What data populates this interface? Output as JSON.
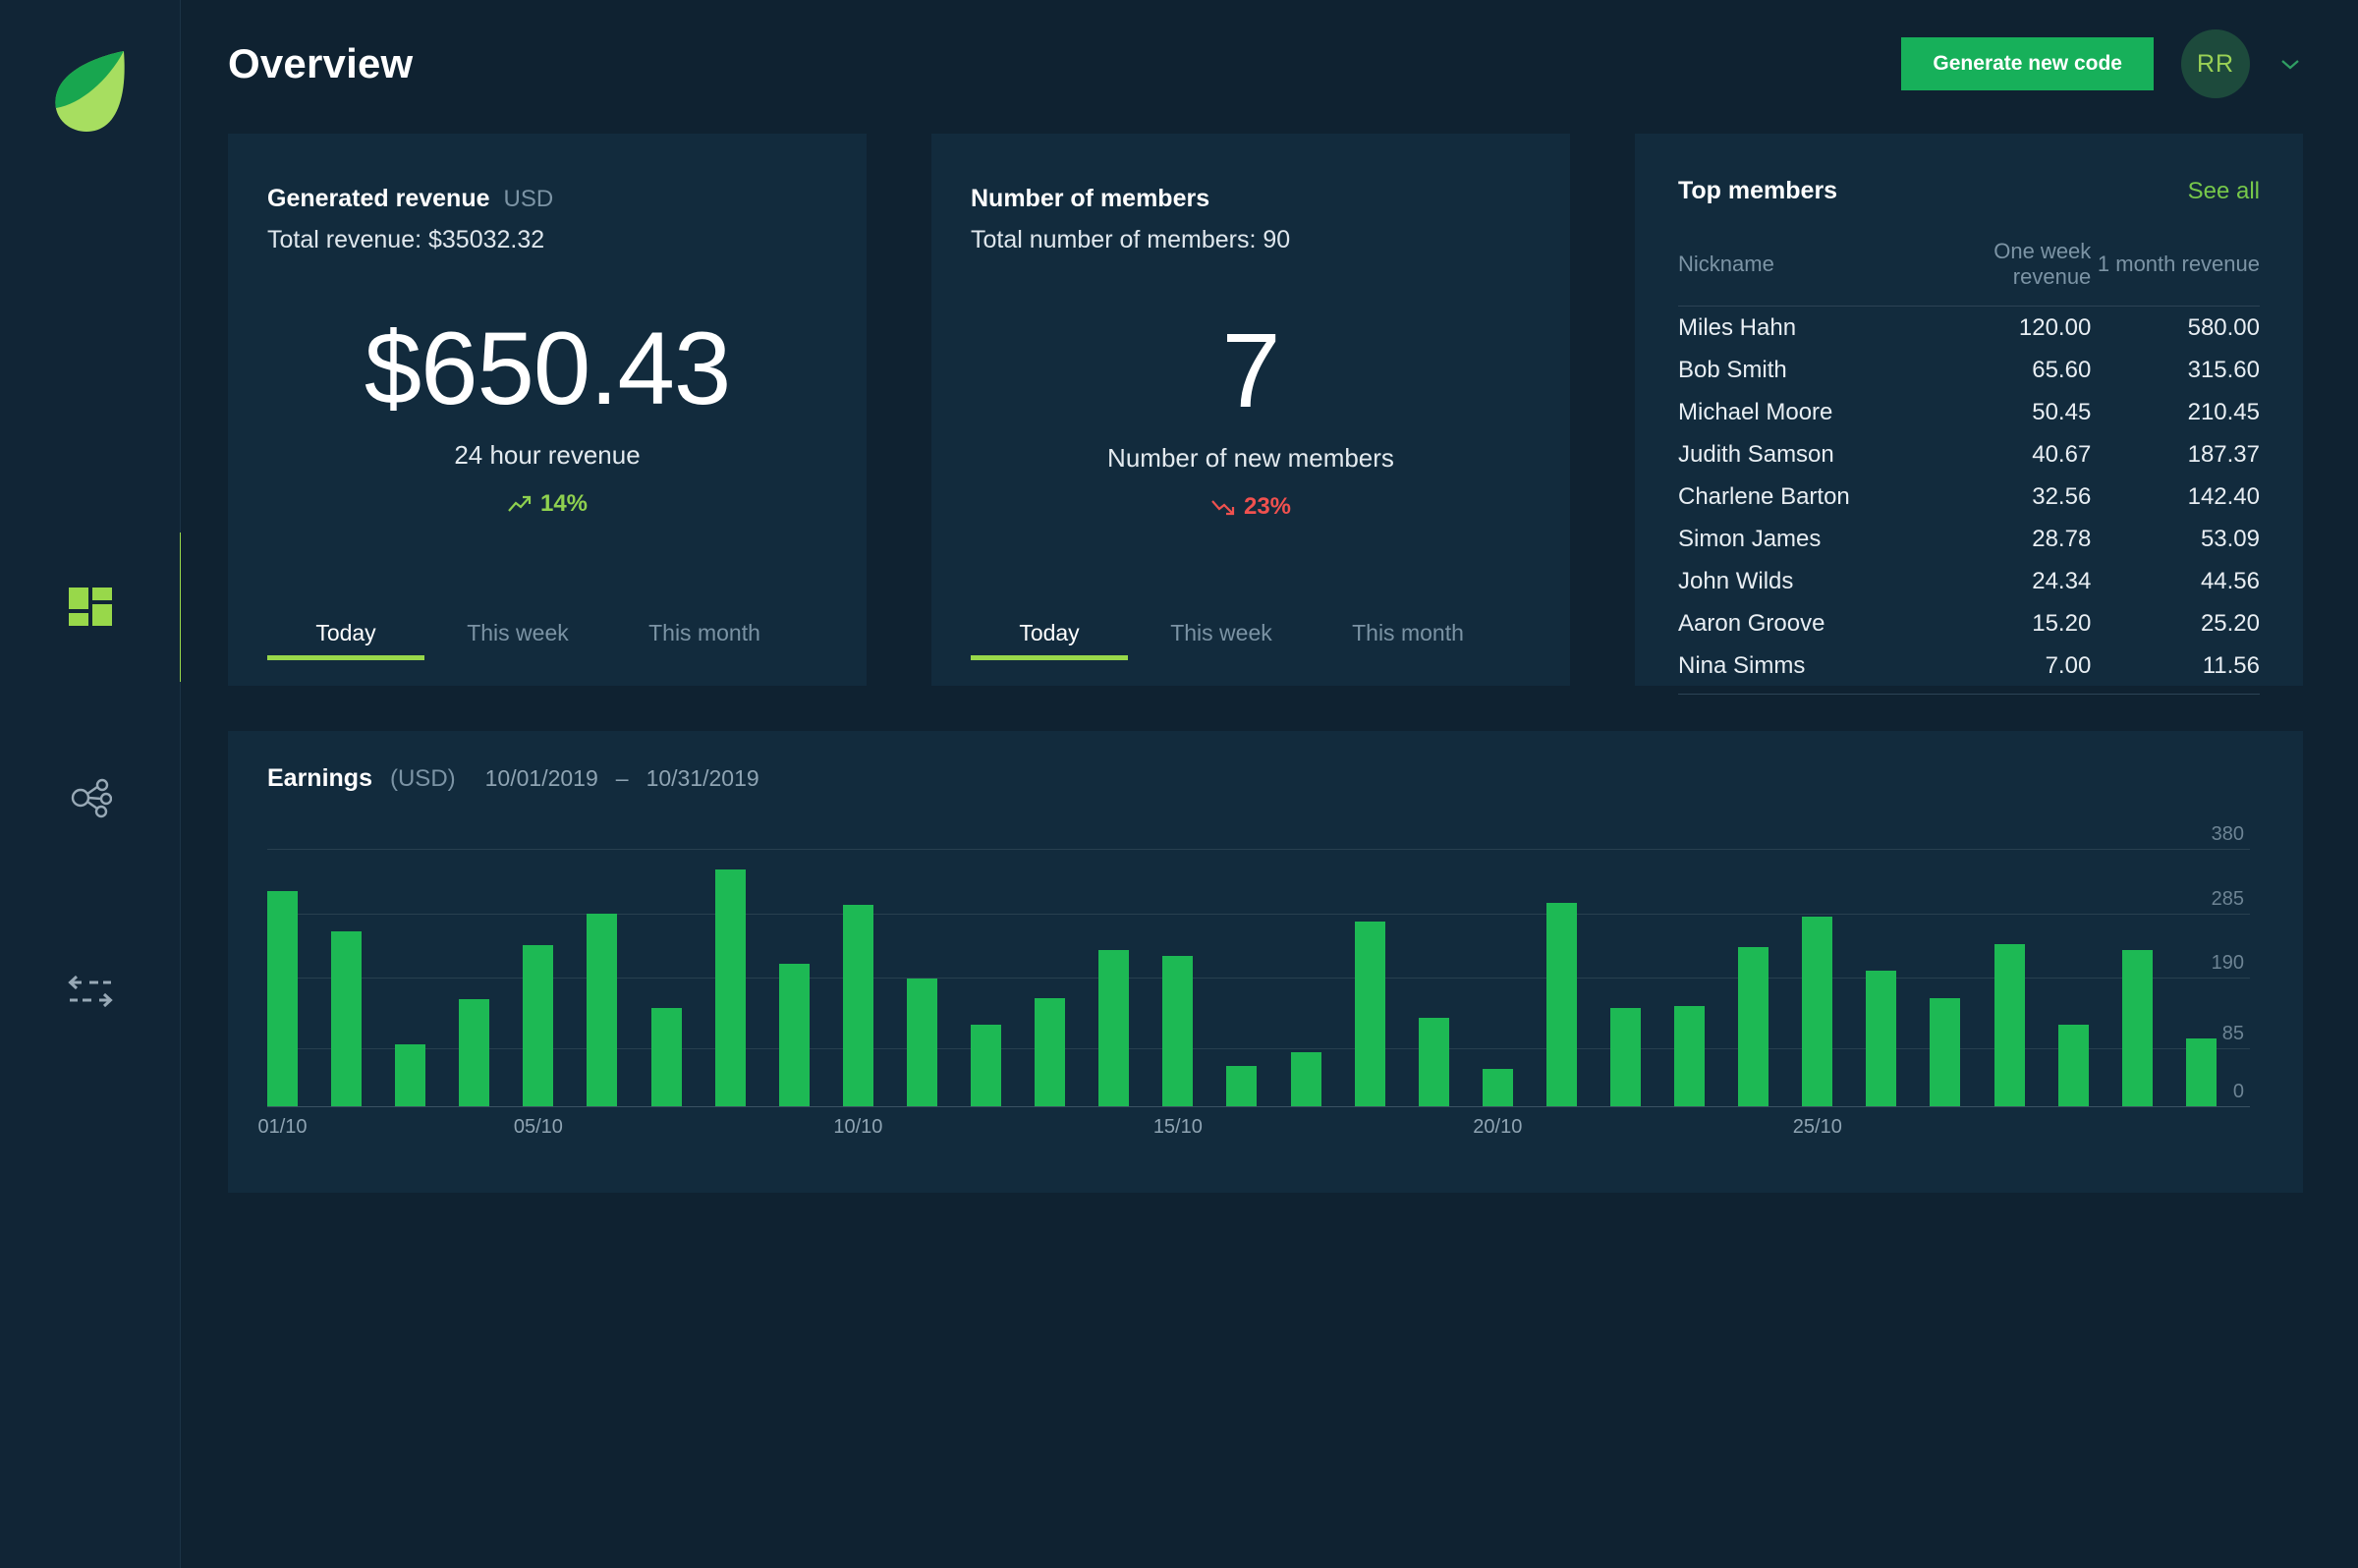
{
  "app": {
    "logo_icon": "leaf-logo",
    "accent_green": "#17b05a",
    "accent_lime": "#98d84a",
    "bg": "#0f2231",
    "card_bg": "#122b3d"
  },
  "sidebar": {
    "items": [
      {
        "icon": "dashboard-grid-icon",
        "label": "Dashboard",
        "active": true
      },
      {
        "icon": "network-share-icon",
        "label": "Referrals",
        "active": false
      },
      {
        "icon": "transfer-arrows-icon",
        "label": "Transfers",
        "active": false
      }
    ]
  },
  "header": {
    "title": "Overview",
    "generate_button": "Generate new code",
    "avatar_initials": "RR",
    "chevron_icon": "chevron-down-icon"
  },
  "revenue_card": {
    "title": "Generated revenue",
    "unit": "USD",
    "subtitle": "Total revenue: $35032.32",
    "value": "$650.43",
    "caption": "24 hour revenue",
    "delta": "14%",
    "delta_direction": "up",
    "delta_icon": "trend-up-icon",
    "delta_color": "#8fd14f",
    "tabs": [
      "Today",
      "This week",
      "This month"
    ],
    "active_tab": "Today"
  },
  "members_card": {
    "title": "Number of members",
    "subtitle": "Total number of members: 90",
    "value": "7",
    "caption": "Number of new members",
    "delta": "23%",
    "delta_direction": "down",
    "delta_icon": "trend-down-icon",
    "delta_color": "#f0514f",
    "tabs": [
      "Today",
      "This week",
      "This month"
    ],
    "active_tab": "Today"
  },
  "top_members": {
    "title": "Top members",
    "see_all": "See all",
    "columns": [
      "Nickname",
      "One week revenue",
      "1 month revenue"
    ],
    "rows": [
      {
        "nickname": "Miles Hahn",
        "week": "120.00",
        "month": "580.00"
      },
      {
        "nickname": "Bob Smith",
        "week": "65.60",
        "month": "315.60"
      },
      {
        "nickname": "Michael Moore",
        "week": "50.45",
        "month": "210.45"
      },
      {
        "nickname": "Judith Samson",
        "week": "40.67",
        "month": "187.37"
      },
      {
        "nickname": "Charlene Barton",
        "week": "32.56",
        "month": "142.40"
      },
      {
        "nickname": "Simon James",
        "week": "28.78",
        "month": "53.09"
      },
      {
        "nickname": "John Wilds",
        "week": "24.34",
        "month": "44.56"
      },
      {
        "nickname": "Aaron Groove",
        "week": "15.20",
        "month": "25.20"
      },
      {
        "nickname": "Nina Simms",
        "week": "7.00",
        "month": "11.56"
      }
    ]
  },
  "earnings": {
    "title": "Earnings",
    "unit": "(USD)",
    "date_from": "10/01/2019",
    "date_sep": "–",
    "date_to": "10/31/2019"
  },
  "chart_data": {
    "type": "bar",
    "title": "Earnings",
    "xlabel": "",
    "ylabel": "USD",
    "ylim": [
      0,
      380
    ],
    "grid": true,
    "bar_color": "#1db954",
    "yticks": [
      0,
      85,
      190,
      285,
      380
    ],
    "xticks": [
      "01/10",
      "05/10",
      "10/10",
      "15/10",
      "20/10",
      "25/10"
    ],
    "xtick_indices": [
      0,
      4,
      9,
      14,
      19,
      24
    ],
    "categories": [
      "01/10",
      "02/10",
      "03/10",
      "04/10",
      "05/10",
      "06/10",
      "07/10",
      "08/10",
      "09/10",
      "10/10",
      "11/10",
      "12/10",
      "13/10",
      "14/10",
      "15/10",
      "16/10",
      "17/10",
      "18/10",
      "19/10",
      "20/10",
      "21/10",
      "22/10",
      "23/10",
      "24/10",
      "25/10",
      "26/10",
      "27/10",
      "28/10",
      "29/10",
      "30/10",
      "31/10"
    ],
    "values": [
      318,
      258,
      91,
      158,
      238,
      284,
      145,
      350,
      210,
      298,
      188,
      120,
      160,
      230,
      222,
      60,
      80,
      272,
      130,
      55,
      300,
      145,
      148,
      235,
      280,
      200,
      160,
      240,
      120,
      230,
      100
    ]
  }
}
